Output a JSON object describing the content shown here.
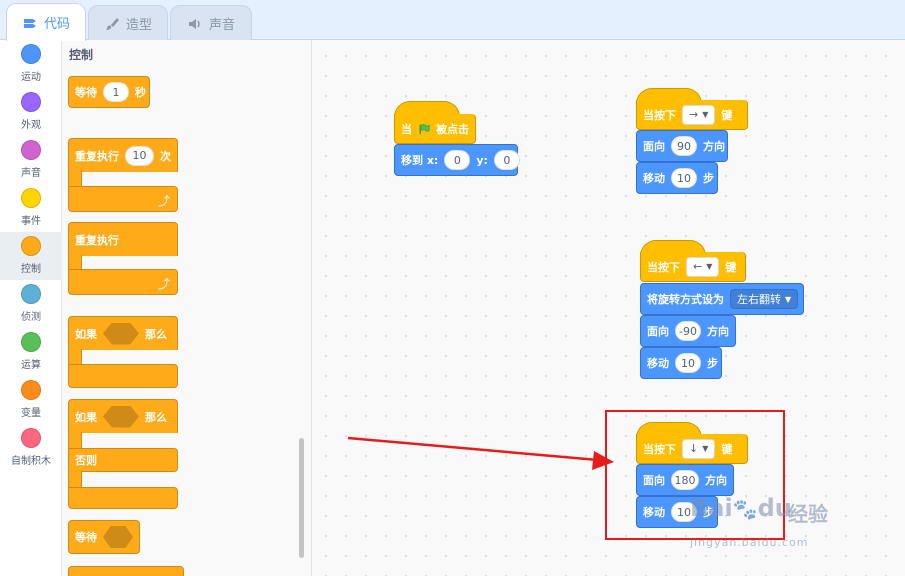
{
  "tabs": [
    {
      "label": "代码",
      "icon": "code-icon",
      "active": true
    },
    {
      "label": "造型",
      "icon": "brush-icon",
      "active": false
    },
    {
      "label": "声音",
      "icon": "speaker-icon",
      "active": false
    }
  ],
  "categories": [
    {
      "label": "运动",
      "color": "#4c97ff"
    },
    {
      "label": "外观",
      "color": "#9966ff"
    },
    {
      "label": "声音",
      "color": "#cf63cf"
    },
    {
      "label": "事件",
      "color": "#ffd500"
    },
    {
      "label": "控制",
      "color": "#ffab19",
      "selected": true
    },
    {
      "label": "侦测",
      "color": "#5cb1d6"
    },
    {
      "label": "运算",
      "color": "#59c059"
    },
    {
      "label": "变量",
      "color": "#ff8c1a"
    },
    {
      "label": "自制积木",
      "color": "#ff6680"
    }
  ],
  "palette": {
    "title": "控制",
    "wait": {
      "label": "等待",
      "value": "1",
      "unit": "秒"
    },
    "repeat": {
      "label": "重复执行",
      "value": "10",
      "unit": "次"
    },
    "forever": {
      "label": "重复执行"
    },
    "if_then": {
      "label": "如果",
      "then": "那么"
    },
    "if_else": {
      "label": "如果",
      "then": "那么",
      "else": "否则"
    },
    "wait_until": {
      "label": "等待"
    }
  },
  "scripts": {
    "flag": {
      "when": "当",
      "clicked": "被点击",
      "goto": "移到 x:",
      "x": "0",
      "ylabel": "y:",
      "y": "0"
    },
    "right": {
      "when": "当按下",
      "key": "→",
      "jian": "键",
      "point": "面向",
      "dir": "90",
      "dirlabel": "方向",
      "move": "移动",
      "steps": "10",
      "bu": "步"
    },
    "left": {
      "when": "当按下",
      "key": "←",
      "jian": "键",
      "rotate": "将旋转方式设为",
      "style": "左右翻转",
      "point": "面向",
      "dir": "-90",
      "dirlabel": "方向",
      "move": "移动",
      "steps": "10",
      "bu": "步"
    },
    "down": {
      "when": "当按下",
      "key": "↓",
      "jian": "键",
      "point": "面向",
      "dir": "180",
      "dirlabel": "方向",
      "move": "移动",
      "steps": "10",
      "bu": "步"
    }
  },
  "watermark": {
    "brand": "Bai",
    "brand2": "du",
    "cn": "经验",
    "url": "jingyan.baidu.com"
  },
  "colors": {
    "control": "#ffab19",
    "event": "#ffbf00",
    "motion": "#4c97ff",
    "highlight": "#e81b1b"
  }
}
